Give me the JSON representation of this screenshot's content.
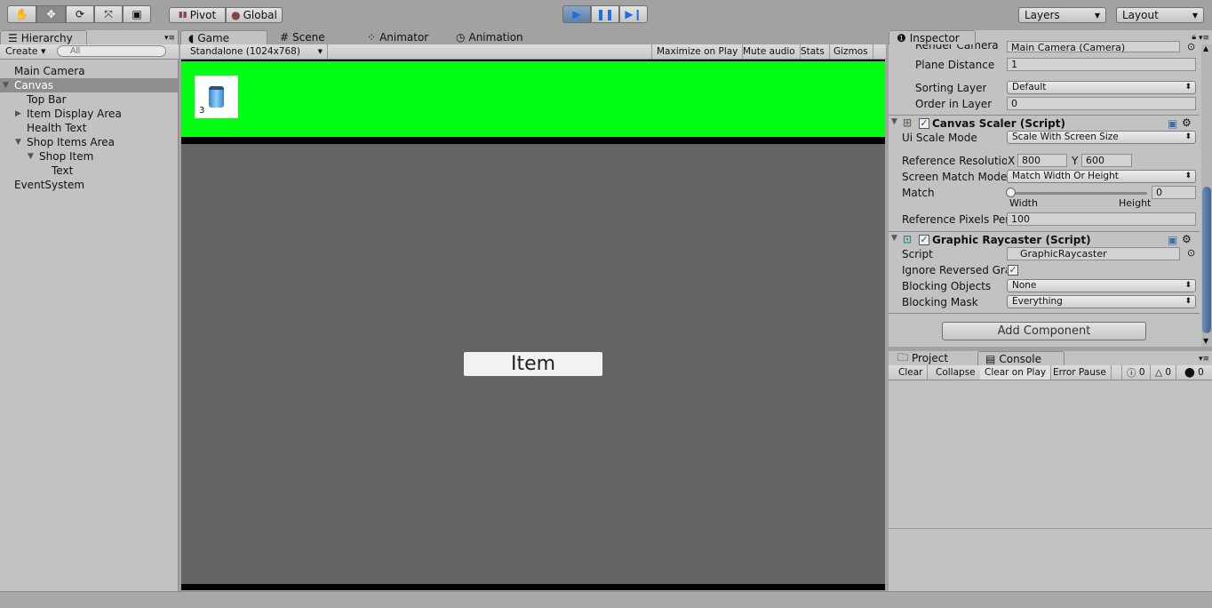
{
  "toolbar": {
    "tools": [
      "hand-tool",
      "move-tool",
      "rotate-tool",
      "scale-tool",
      "rect-tool"
    ],
    "pivot": "Pivot",
    "global": "Global",
    "layers": "Layers",
    "layout": "Layout"
  },
  "hierarchy": {
    "tab": "Hierarchy",
    "create": "Create",
    "search_placeholder": "All",
    "items": [
      {
        "label": "Main Camera",
        "indent": 0,
        "arrow": ""
      },
      {
        "label": "Canvas",
        "indent": 0,
        "arrow": "▼",
        "selected": true
      },
      {
        "label": "Top Bar",
        "indent": 1,
        "arrow": ""
      },
      {
        "label": "Item Display Area",
        "indent": 1,
        "arrow": "▶"
      },
      {
        "label": "Health Text",
        "indent": 1,
        "arrow": ""
      },
      {
        "label": "Shop Items Area",
        "indent": 1,
        "arrow": "▼"
      },
      {
        "label": "Shop Item",
        "indent": 2,
        "arrow": "▼"
      },
      {
        "label": "Text",
        "indent": 3,
        "arrow": ""
      },
      {
        "label": "EventSystem",
        "indent": 0,
        "arrow": ""
      }
    ]
  },
  "game": {
    "tabs": [
      "Game",
      "Scene",
      "Animator",
      "Animation"
    ],
    "resolution": "Standalone (1024x768)",
    "maximize": "Maximize on Play",
    "mute": "Mute audio",
    "stats": "Stats",
    "gizmos": "Gizmos",
    "item_count": "3",
    "button_label": "Item",
    "top_bar_color": "#00ff14"
  },
  "inspector": {
    "tab": "Inspector",
    "render_camera_label": "Render Camera",
    "render_camera": "Main Camera (Camera)",
    "plane_distance_label": "Plane Distance",
    "plane_distance": "1",
    "sorting_layer_label": "Sorting Layer",
    "sorting_layer": "Default",
    "order_label": "Order in Layer",
    "order": "0",
    "canvas_scaler": {
      "title": "Canvas Scaler (Script)",
      "ui_scale_label": "Ui Scale Mode",
      "ui_scale": "Scale With Screen Size",
      "ref_res_label": "Reference Resolution",
      "x_label": "X",
      "x": "800",
      "y_label": "Y",
      "y": "600",
      "match_mode_label": "Screen Match Mode",
      "match_mode": "Match Width Or Height",
      "match_label": "Match",
      "match": "0",
      "width_label": "Width",
      "height_label": "Height",
      "ref_px_label": "Reference Pixels Per Unit",
      "ref_px": "100"
    },
    "raycaster": {
      "title": "Graphic Raycaster (Script)",
      "script_label": "Script",
      "script": "GraphicRaycaster",
      "ignore_label": "Ignore Reversed Graphics",
      "ignore": true,
      "blocking_objects_label": "Blocking Objects",
      "blocking_objects": "None",
      "blocking_mask_label": "Blocking Mask",
      "blocking_mask": "Everything"
    },
    "add_component": "Add Component"
  },
  "console": {
    "tabs": [
      "Project",
      "Console"
    ],
    "clear": "Clear",
    "collapse": "Collapse",
    "clear_on_play": "Clear on Play",
    "error_pause": "Error Pause",
    "info_count": "0",
    "warn_count": "0",
    "error_count": "0"
  }
}
